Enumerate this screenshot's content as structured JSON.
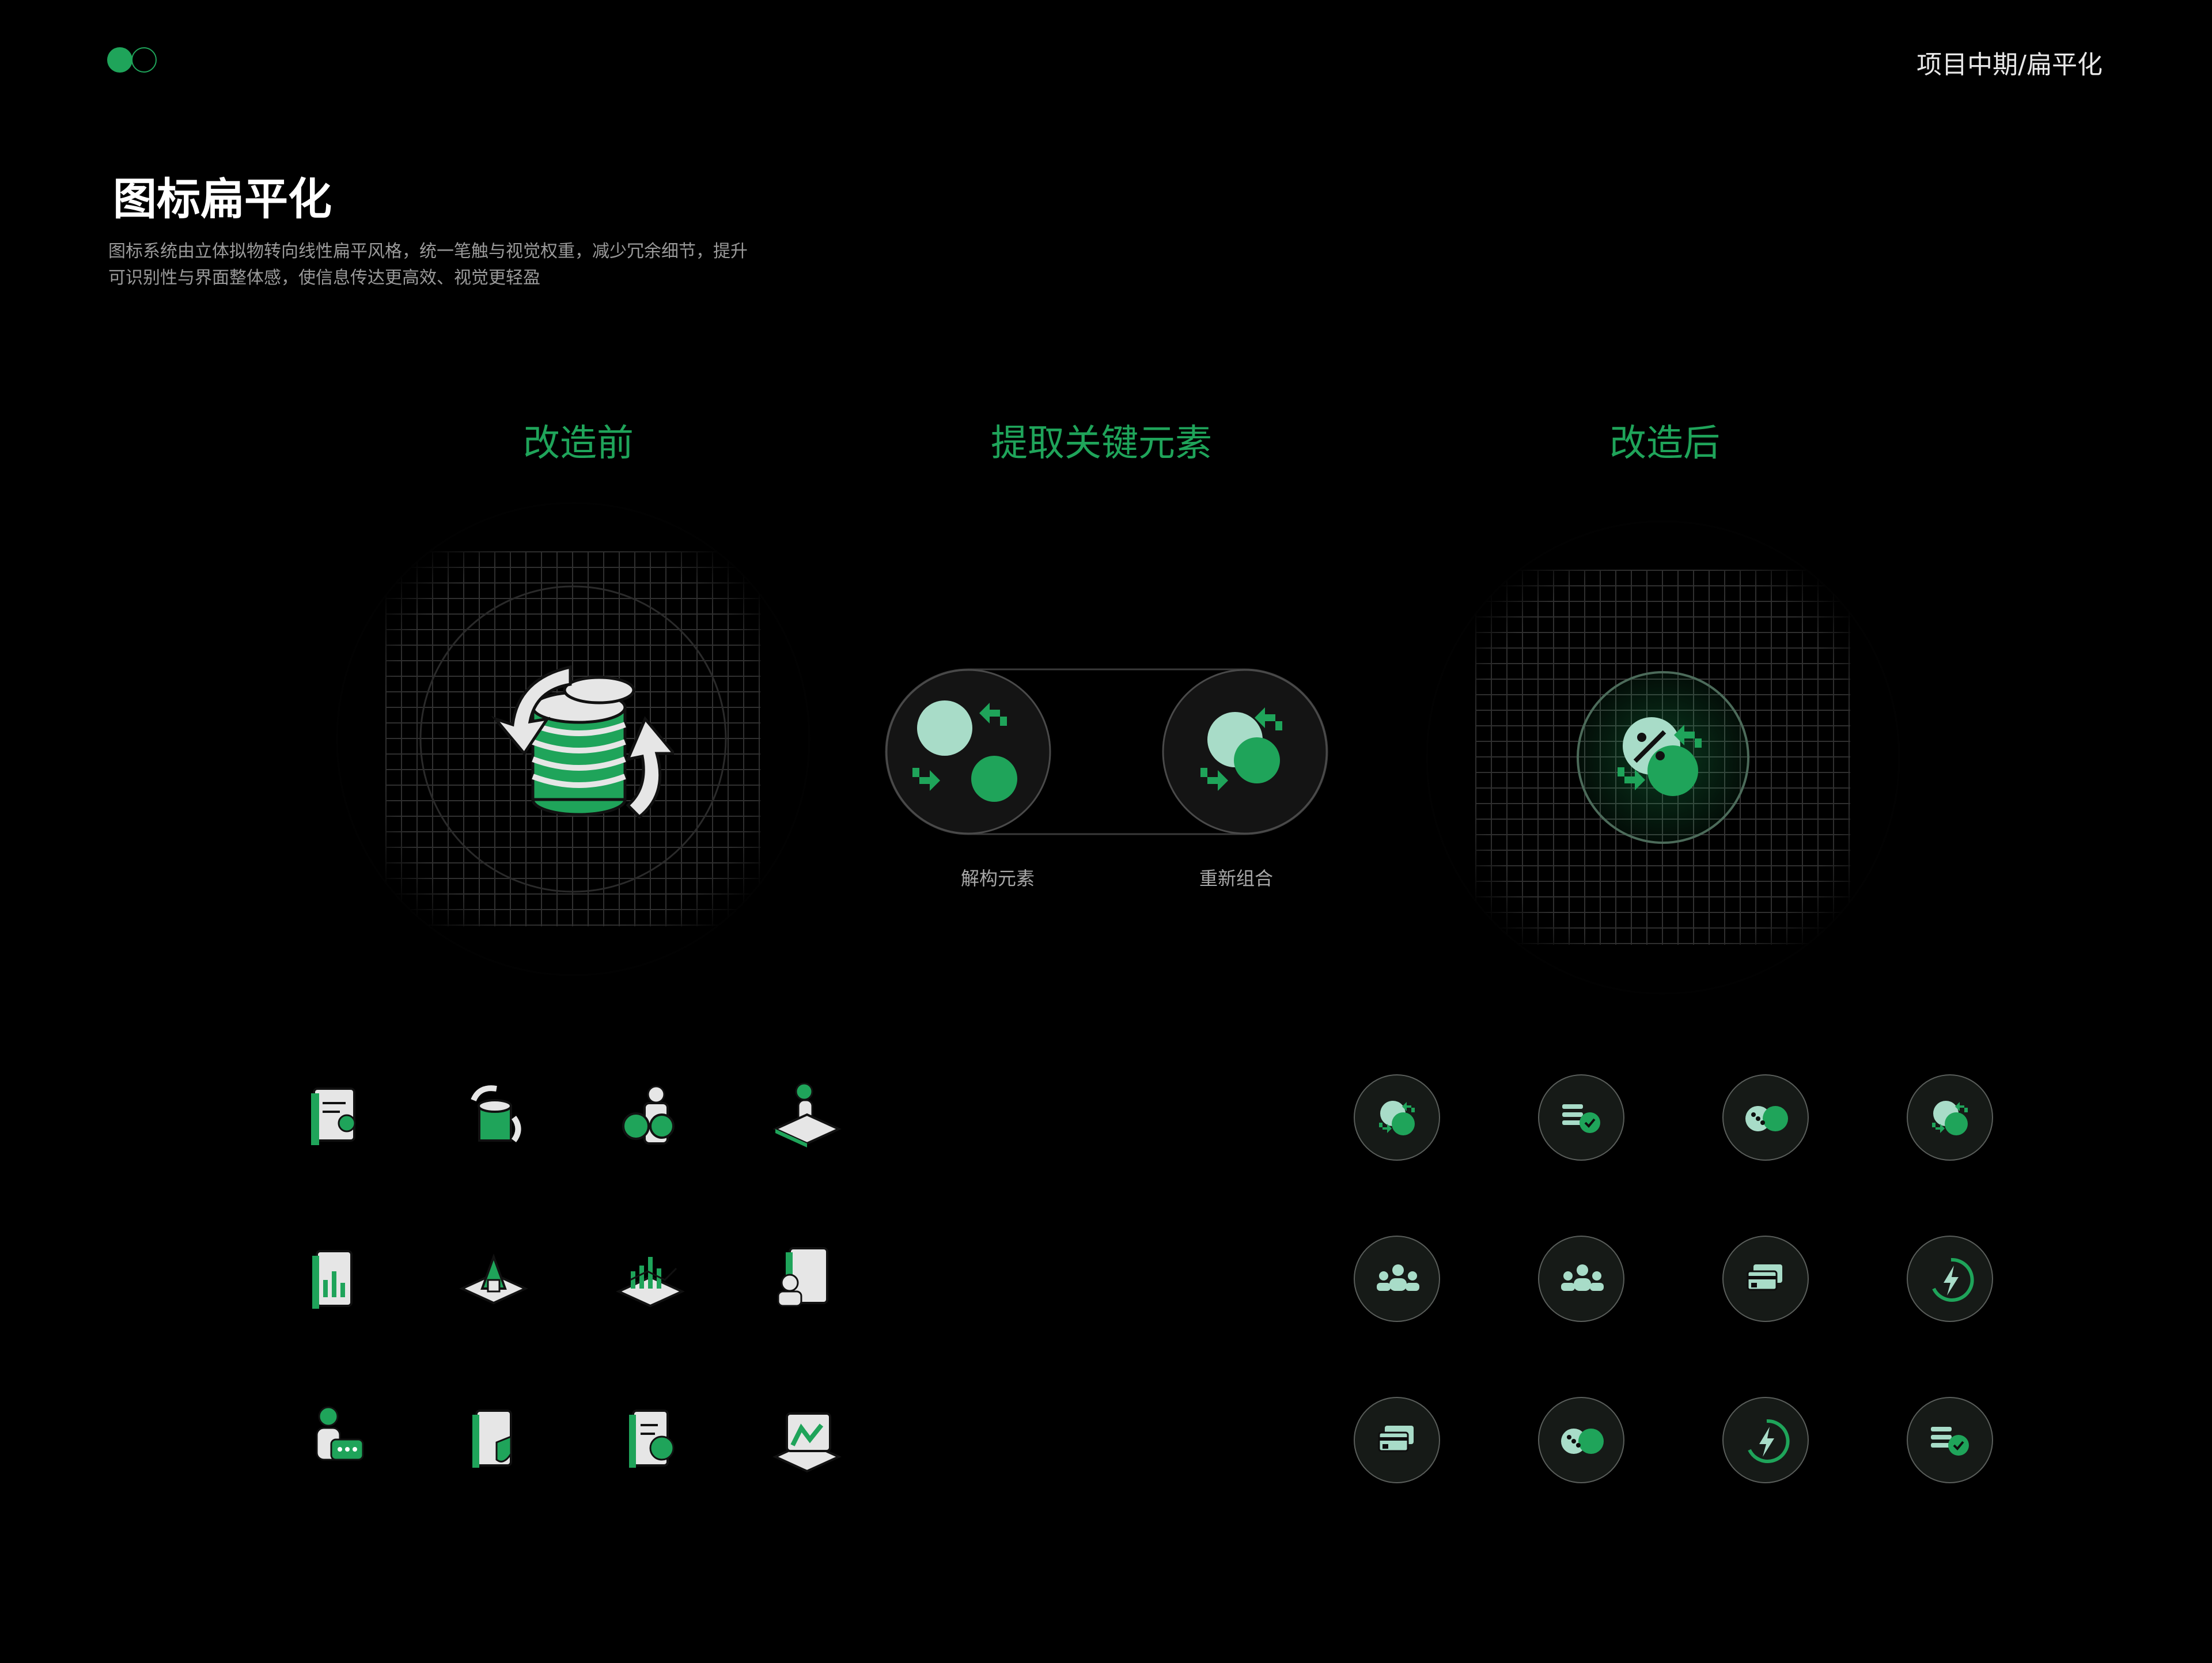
{
  "header": {
    "breadcrumb": "项目中期/扁平化"
  },
  "section": {
    "title": "图标扁平化",
    "description_lines": [
      "图标系统由立体拟物转向线性扁平风格，统一笔触与视觉权重，减少冗余细节，提升",
      "可识别性与界面整体感，使信息传达更高效、视觉更轻盈"
    ]
  },
  "columns": {
    "before": "改造前",
    "extract": "提取关键元素",
    "after": "改造后"
  },
  "captions": {
    "deconstruct": "解构元素",
    "recombine": "重新组合"
  },
  "colors": {
    "accent": "#1fa45a",
    "accent_light": "#a8dcc8",
    "background": "#000000"
  },
  "icons": {
    "before_grid": [
      "id-card-person-icon",
      "coin-exchange-icon",
      "person-bitcoin-icon",
      "person-desk-icon",
      "bar-chart-book-icon",
      "chart-platform-icon",
      "growth-chart-icon",
      "documents-person-icon",
      "person-chat-icon",
      "document-shield-icon",
      "document-chart-icon",
      "screen-chart-icon"
    ],
    "after_grid": [
      "percent-exchange-icon",
      "coin-stack-check-icon",
      "coins-percent-icon",
      "percent-exchange-icon",
      "group-people-icon",
      "group-people-icon",
      "card-stack-icon",
      "lightning-refresh-icon",
      "card-stack-icon",
      "coins-percent-icon",
      "lightning-refresh-icon",
      "coin-stack-check-icon"
    ]
  }
}
